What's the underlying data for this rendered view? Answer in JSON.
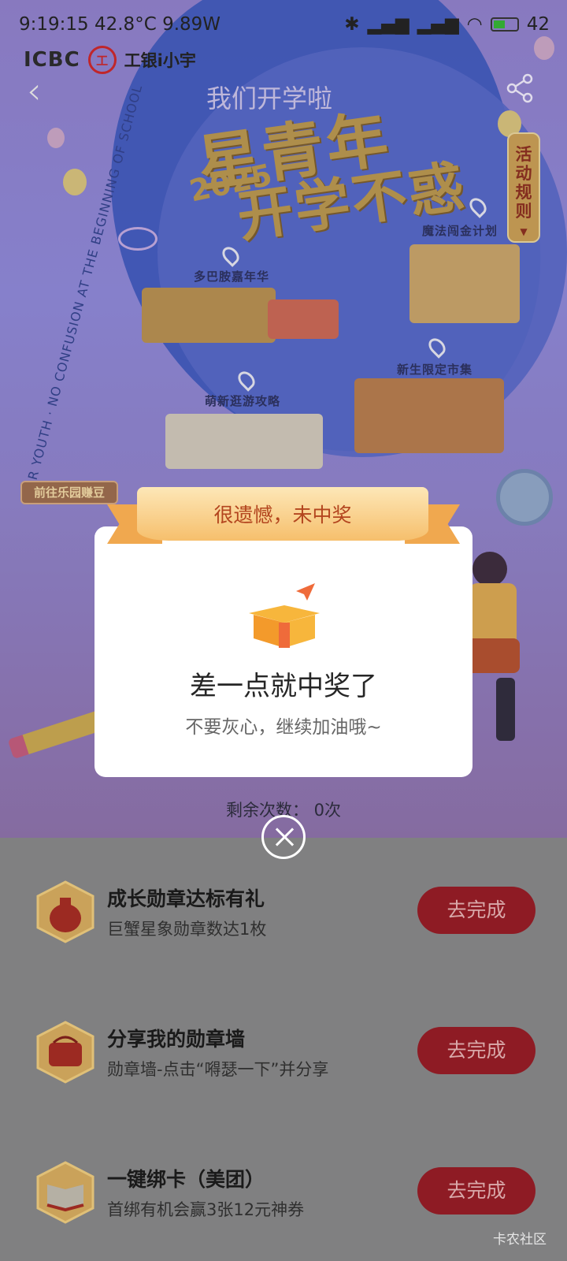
{
  "status_bar": {
    "time": "9:19:15",
    "temperature": "42.8°C",
    "power": "9.89W",
    "battery": "42"
  },
  "brand": {
    "bank": "ICBC",
    "seal": "工",
    "name": "工银i小宇"
  },
  "hero": {
    "title_top": "我们开学啦",
    "title_main": "星青年",
    "year": "2025",
    "title_sub": "开学不惑",
    "side_text": "STAR YOUTH · NO CONFUSION AT THE BEGINNING OF SCHOOL",
    "rules_tab": "活动规则",
    "go_tag": "前往乐园赚豆",
    "map_labels": [
      "多巴胺嘉年华",
      "魔法闯金计划",
      "萌新逛游攻略",
      "新生限定市集"
    ],
    "remaining": "剩余次数：  0次"
  },
  "modal": {
    "ribbon": "很遗憾，未中奖",
    "title": "差一点就中奖了",
    "subtitle": "不要灰心，继续加油哦~"
  },
  "tasks": [
    {
      "title": "成长勋章达标有礼",
      "desc": "巨蟹星象勋章数达1枚",
      "button": "去完成",
      "icon": "money-bag-icon"
    },
    {
      "title": "分享我的勋章墙",
      "desc": "勋章墙-点击“嘚瑟一下”并分享",
      "button": "去完成",
      "icon": "wallet-icon"
    },
    {
      "title": "一键绑卡（美团）",
      "desc": "首绑有机会赢3张12元神券",
      "button": "去完成",
      "icon": "book-icon"
    }
  ],
  "watermark": "卡农社区",
  "colors": {
    "accent_red": "#8e1b24",
    "ribbon": "#f6bf6c",
    "gold_title": "#b8954b"
  }
}
